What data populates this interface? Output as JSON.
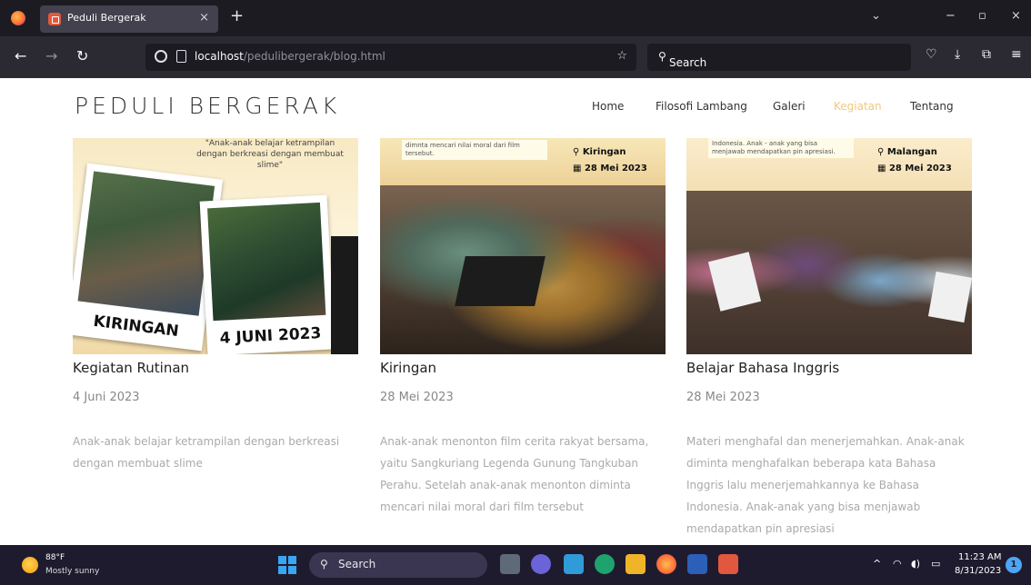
{
  "browser": {
    "tab_title": "Peduli Bergerak",
    "tab_close": "×",
    "new_tab": "+",
    "url_host": "localhost",
    "url_path": "/pedulibergerak/blog.html",
    "search_placeholder": "Search",
    "window_controls": {
      "chevron": "⌄",
      "minimize": "−",
      "restore": "▫",
      "close": "×"
    }
  },
  "site": {
    "brand": "PEDULI BERGERAK",
    "nav": [
      "Home",
      "Filosofi Lambang",
      "Galeri",
      "Kegiatan",
      "Tentang"
    ],
    "active_nav": "Kegiatan"
  },
  "cards": [
    {
      "image_quote": "\"Anak-anak belajar ketrampilan dengan berkreasi dengan membuat slime\"",
      "image_label_place": "KIRINGAN",
      "image_label_date": "4 JUNI 2023",
      "title": "Kegiatan Rutinan",
      "date": "4 Juni 2023",
      "description": "Anak-anak belajar ketrampilan dengan berkreasi dengan membuat slime"
    },
    {
      "image_note": "dimnta mencari nilai moral dari film tersebut.",
      "image_place": "Kiringan",
      "image_date": "28 Mei 2023",
      "title": "Kiringan",
      "date": "28 Mei 2023",
      "description": "Anak-anak menonton film cerita rakyat bersama, yaitu Sangkuriang Legenda Gunung Tangkuban Perahu. Setelah anak-anak menonton diminta mencari nilai moral dari film tersebut"
    },
    {
      "image_note": "Indonesia. Anak - anak yang bisa menjawab mendapatkan pin apresiasi.",
      "image_place": "Malangan",
      "image_date": "28 Mei 2023",
      "title": "Belajar Bahasa Inggris",
      "date": "28 Mei 2023",
      "description": "Materi menghafal dan menerjemahkan. Anak-anak diminta menghafalkan beberapa kata Bahasa Inggris lalu menerjemahkannya ke Bahasa Indonesia. Anak-anak yang bisa menjawab mendapatkan pin apresiasi"
    }
  ],
  "taskbar": {
    "weather_temp": "88°F",
    "weather_desc": "Mostly sunny",
    "search_label": "Search",
    "time": "11:23 AM",
    "date": "8/31/2023",
    "notification_count": "1"
  },
  "colors": {
    "accent_nav": "#f2c97a",
    "taskbar": "#1f1b2e",
    "browser_toolbar": "#2b2a33"
  }
}
